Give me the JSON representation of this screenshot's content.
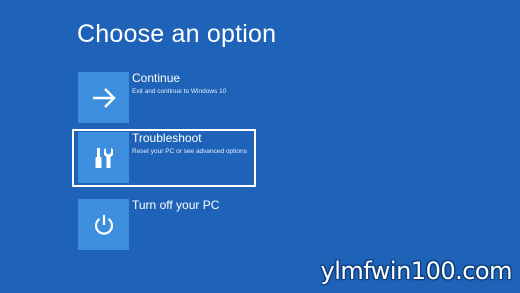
{
  "screen": {
    "title": "Choose an option"
  },
  "options": [
    {
      "label": "Continue",
      "description": "Exit and continue to Windows 10",
      "icon": "arrow-right-icon",
      "selected": false
    },
    {
      "label": "Troubleshoot",
      "description": "Reset your PC or see advanced options",
      "icon": "tools-icon",
      "selected": true
    },
    {
      "label": "Turn off your PC",
      "description": "",
      "icon": "power-icon",
      "selected": false
    }
  ],
  "watermark": {
    "text": "ylmfwin100.com"
  },
  "colors": {
    "background": "#1e63b8",
    "tile": "#3d8fde",
    "selection_border": "#ffffff",
    "text": "#ffffff"
  }
}
